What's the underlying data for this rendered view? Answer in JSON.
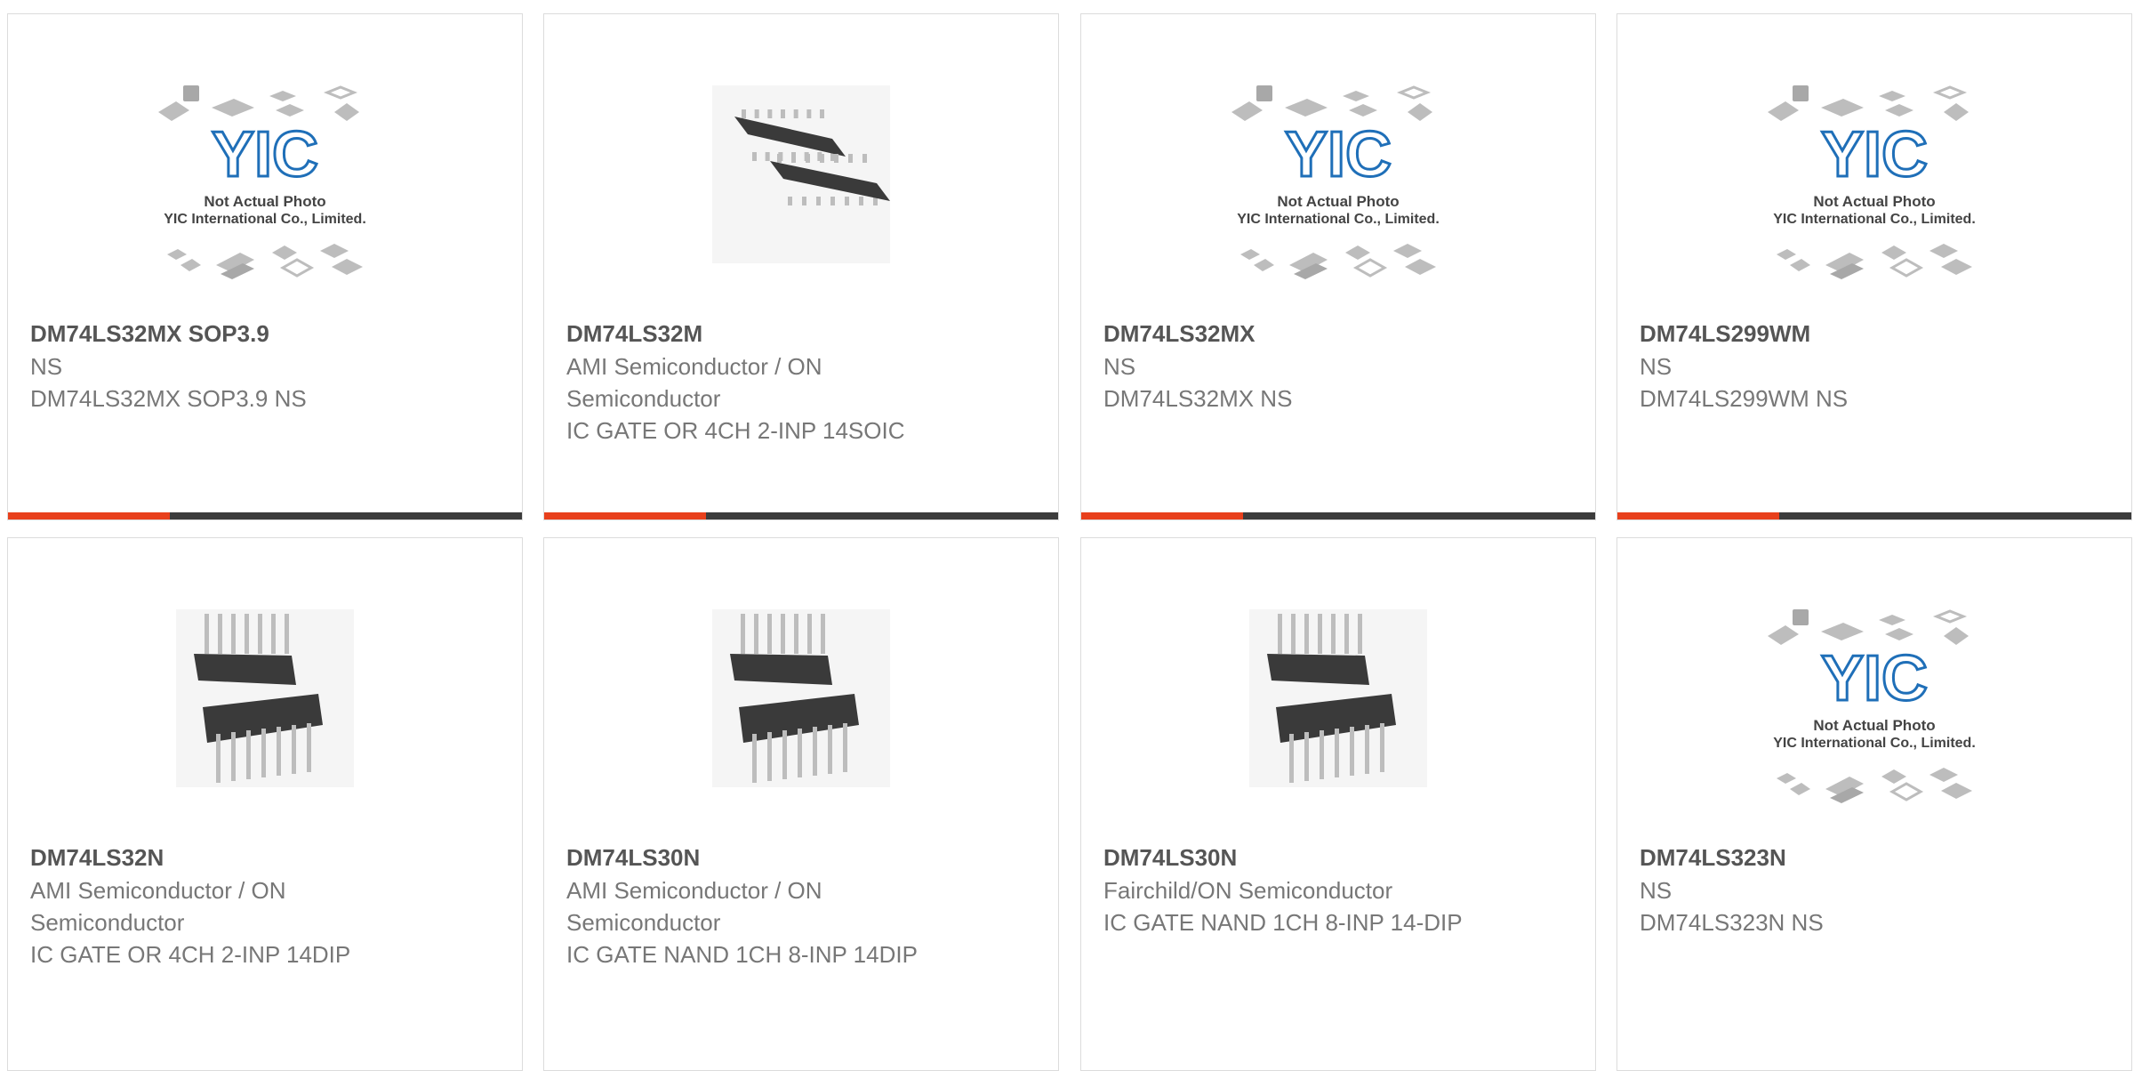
{
  "colors": {
    "accent": "#e8401c",
    "dark": "#3c3c3c",
    "yic_blue": "#1f6fb8",
    "chip": "#3a3a3a",
    "pin": "#bdbdbd",
    "placeholder_pkg": "#bdbdbd"
  },
  "placeholder": {
    "logo_text": "YIC",
    "line1": "Not Actual Photo",
    "line2": "YIC International Co., Limited."
  },
  "products": [
    {
      "part": "DM74LS32MX SOP3.9",
      "manufacturer": "NS",
      "description": "DM74LS32MX SOP3.9 NS",
      "image": "yic-placeholder-icon"
    },
    {
      "part": "DM74LS32M",
      "manufacturer": "AMI Semiconductor / ON Semiconductor",
      "description": "IC GATE OR 4CH 2-INP 14SOIC",
      "image": "soic-chip-icon"
    },
    {
      "part": "DM74LS32MX",
      "manufacturer": "NS",
      "description": "DM74LS32MX NS",
      "image": "yic-placeholder-icon"
    },
    {
      "part": "DM74LS299WM",
      "manufacturer": "NS",
      "description": "DM74LS299WM NS",
      "image": "yic-placeholder-icon"
    },
    {
      "part": "DM74LS32N",
      "manufacturer": "AMI Semiconductor / ON Semiconductor",
      "description": "IC GATE OR 4CH 2-INP 14DIP",
      "image": "dip-chip-icon"
    },
    {
      "part": "DM74LS30N",
      "manufacturer": "AMI Semiconductor / ON Semiconductor",
      "description": "IC GATE NAND 1CH 8-INP 14DIP",
      "image": "dip-chip-icon"
    },
    {
      "part": "DM74LS30N",
      "manufacturer": "Fairchild/ON Semiconductor",
      "description": "IC GATE NAND 1CH 8-INP 14-DIP",
      "image": "dip-chip-icon"
    },
    {
      "part": "DM74LS323N",
      "manufacturer": "NS",
      "description": "DM74LS323N NS",
      "image": "yic-placeholder-icon"
    }
  ]
}
